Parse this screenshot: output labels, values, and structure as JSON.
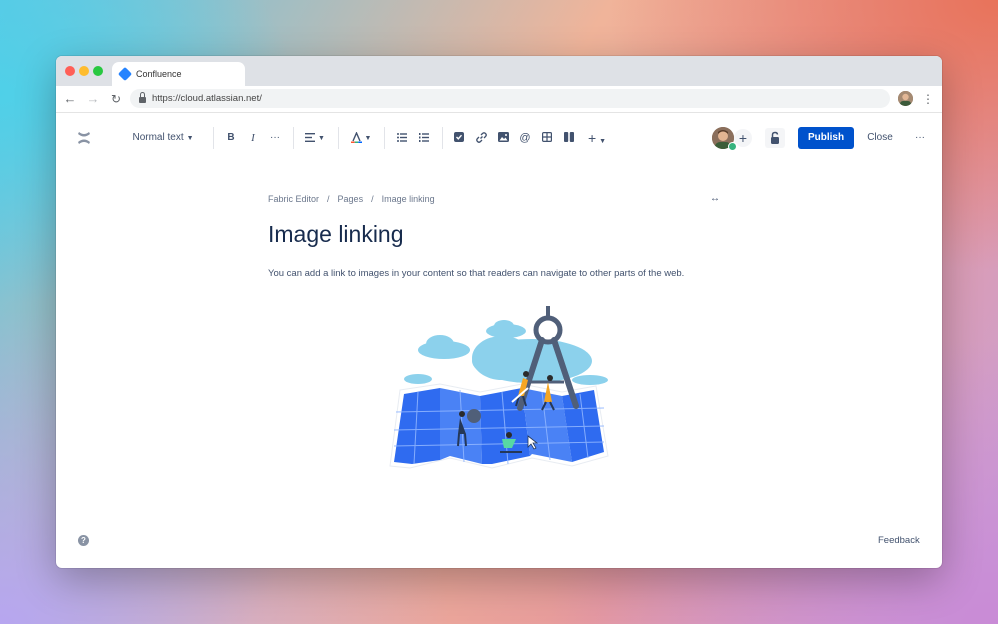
{
  "browser": {
    "tab_title": "Confluence",
    "url": "https://cloud.atlassian.net/",
    "icons": {
      "back": "arrow-left-icon",
      "forward": "arrow-right-icon",
      "reload": "reload-icon",
      "lock": "lock-icon",
      "menu": "kebab-vertical-icon"
    }
  },
  "toolbar": {
    "text_style": "Normal text",
    "bold": "B",
    "italic": "I",
    "more_formatting": "···",
    "add_more": "+",
    "publish_label": "Publish",
    "close_label": "Close",
    "more_label": "···",
    "add_collaborator": "+"
  },
  "page": {
    "breadcrumb": [
      "Fabric Editor",
      "Pages",
      "Image linking"
    ],
    "breadcrumb_separator": "/",
    "title": "Image linking",
    "body": "You can add a link to images in your content so that readers can navigate to other parts of the web."
  },
  "footer": {
    "help": "?",
    "feedback": "Feedback"
  },
  "colors": {
    "publish": "#0052cc",
    "map_blue": "#2f6bf0",
    "cloud": "#8cd1ec",
    "heading": "#172b4d"
  }
}
